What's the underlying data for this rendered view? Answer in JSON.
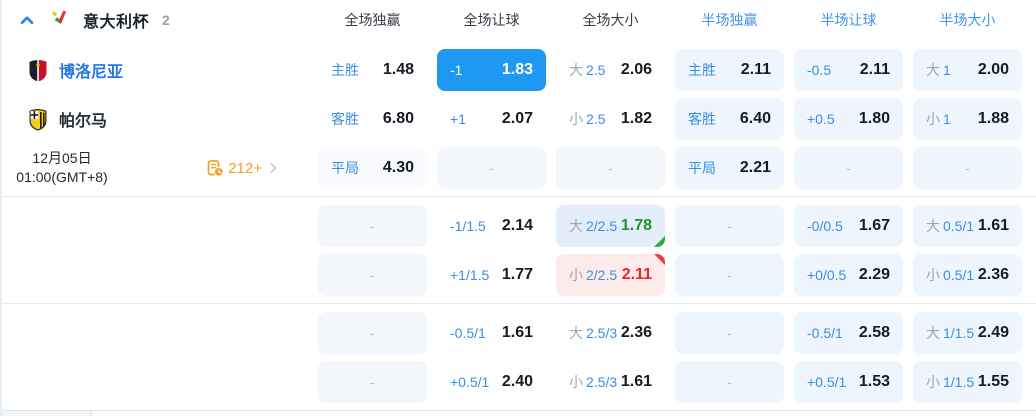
{
  "header": {
    "league": "意大利杯",
    "count": "2",
    "columns": [
      {
        "label": "全场独赢",
        "tone": "dark"
      },
      {
        "label": "全场让球",
        "tone": "dark"
      },
      {
        "label": "全场大小",
        "tone": "dark"
      },
      {
        "label": "半场独赢",
        "tone": "blue"
      },
      {
        "label": "半场让球",
        "tone": "blue"
      },
      {
        "label": "半场大小",
        "tone": "blue"
      }
    ]
  },
  "match": {
    "home_name": "博洛尼亚",
    "away_name": "帕尔马",
    "date": "12月05日",
    "time": "01:00(GMT+8)",
    "markets_count": "212+"
  },
  "colors": {
    "accent_blue": "#1f98f4",
    "label_blue": "#3a8ee6",
    "up_green": "#1d9627",
    "down_red": "#f02222",
    "link_orange": "#f59d25"
  },
  "odds": {
    "rows": [
      {
        "cells": [
          {
            "label": "主胜",
            "value": "1.48",
            "state": "plain"
          },
          {
            "label": "-1",
            "value": "1.83",
            "state": "selected"
          },
          {
            "prefix": "大",
            "label": "2.5",
            "value": "2.06",
            "state": "plain"
          },
          {
            "label": "主胜",
            "value": "2.11",
            "state": "half"
          },
          {
            "label": "-0.5",
            "value": "2.11",
            "state": "half"
          },
          {
            "prefix": "大",
            "label": "1",
            "value": "2.00",
            "state": "half"
          }
        ]
      },
      {
        "cells": [
          {
            "label": "客胜",
            "value": "6.80",
            "state": "plain"
          },
          {
            "label": "+1",
            "value": "2.07",
            "state": "plain"
          },
          {
            "prefix": "小",
            "label": "2.5",
            "value": "1.82",
            "state": "plain"
          },
          {
            "label": "客胜",
            "value": "6.40",
            "state": "half"
          },
          {
            "label": "+0.5",
            "value": "1.80",
            "state": "half"
          },
          {
            "prefix": "小",
            "label": "1",
            "value": "1.88",
            "state": "half"
          }
        ]
      },
      {
        "cells": [
          {
            "label": "平局",
            "value": "4.30",
            "state": "soft"
          },
          {
            "dash": "-",
            "state": "softer"
          },
          {
            "dash": "-",
            "state": "softer"
          },
          {
            "label": "平局",
            "value": "2.21",
            "state": "half"
          },
          {
            "dash": "-",
            "state": "half"
          },
          {
            "dash": "-",
            "state": "half"
          }
        ]
      },
      {
        "cells": [
          {
            "dash": "-",
            "state": "softer"
          },
          {
            "label": "-1/1.5",
            "value": "2.14",
            "state": "plain"
          },
          {
            "prefix": "大",
            "label": "2/2.5",
            "value": "1.78",
            "state": "up"
          },
          {
            "dash": "-",
            "state": "half"
          },
          {
            "label": "-0/0.5",
            "value": "1.67",
            "state": "half"
          },
          {
            "prefix": "大",
            "label": "0.5/1",
            "value": "1.61",
            "state": "half"
          }
        ]
      },
      {
        "cells": [
          {
            "dash": "-",
            "state": "softer"
          },
          {
            "label": "+1/1.5",
            "value": "1.77",
            "state": "plain"
          },
          {
            "prefix": "小",
            "label": "2/2.5",
            "value": "2.11",
            "state": "down"
          },
          {
            "dash": "-",
            "state": "half"
          },
          {
            "label": "+0/0.5",
            "value": "2.29",
            "state": "half"
          },
          {
            "prefix": "小",
            "label": "0.5/1",
            "value": "2.36",
            "state": "half"
          }
        ]
      },
      {
        "cells": [
          {
            "dash": "-",
            "state": "softer"
          },
          {
            "label": "-0.5/1",
            "value": "1.61",
            "state": "plain"
          },
          {
            "prefix": "大",
            "label": "2.5/3",
            "value": "2.36",
            "state": "plain"
          },
          {
            "dash": "-",
            "state": "half"
          },
          {
            "label": "-0.5/1",
            "value": "2.58",
            "state": "half"
          },
          {
            "prefix": "大",
            "label": "1/1.5",
            "value": "2.49",
            "state": "half"
          }
        ]
      },
      {
        "cells": [
          {
            "dash": "-",
            "state": "softer"
          },
          {
            "label": "+0.5/1",
            "value": "2.40",
            "state": "plain"
          },
          {
            "prefix": "小",
            "label": "2.5/3",
            "value": "1.61",
            "state": "plain"
          },
          {
            "dash": "-",
            "state": "half"
          },
          {
            "label": "+0.5/1",
            "value": "1.53",
            "state": "half"
          },
          {
            "prefix": "小",
            "label": "1/1.5",
            "value": "1.55",
            "state": "half"
          }
        ]
      }
    ]
  }
}
